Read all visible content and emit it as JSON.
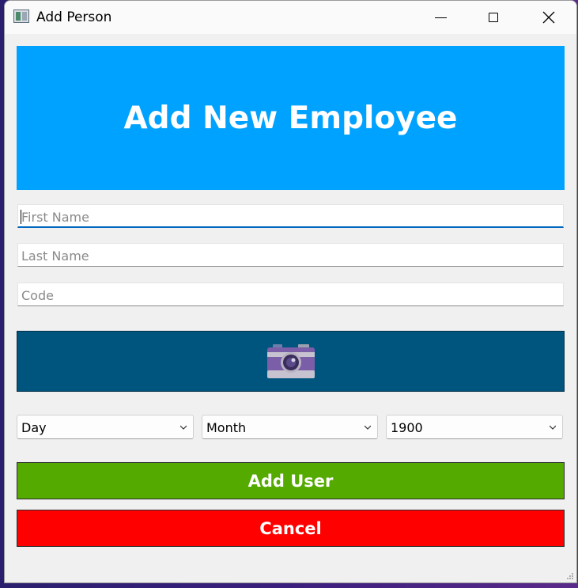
{
  "window": {
    "title": "Add Person",
    "icon": "app-window-icon",
    "controls": [
      "minimize-icon",
      "maximize-icon",
      "close-icon"
    ]
  },
  "banner": {
    "text": "Add New Employee",
    "color": "#00a2ff"
  },
  "form": {
    "first_name": {
      "placeholder": "First Name",
      "value": ""
    },
    "last_name": {
      "placeholder": "Last Name",
      "value": ""
    },
    "code": {
      "placeholder": "Code",
      "value": ""
    }
  },
  "photo_button": {
    "icon": "camera-icon",
    "color": "#00557f"
  },
  "birth_date": {
    "day": "Day",
    "month": "Month",
    "year": "1900"
  },
  "buttons": {
    "add_user": "Add User",
    "cancel": "Cancel"
  },
  "colors": {
    "add_user": "#55aa00",
    "cancel": "#ff0000",
    "focus_underline": "#0067c0"
  }
}
